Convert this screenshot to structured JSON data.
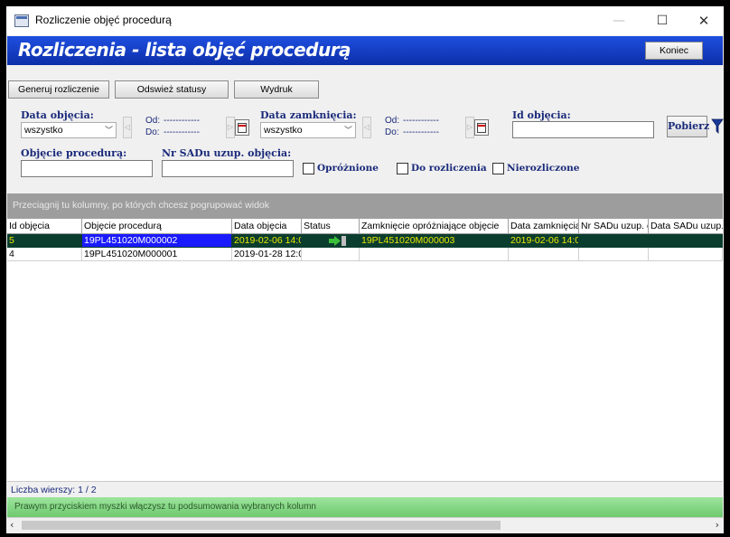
{
  "window": {
    "title": "Rozliczenie objęć procedurą",
    "min": "—",
    "max": "☐",
    "close": "✕"
  },
  "header": {
    "title": "Rozliczenia - lista objęć procedurą",
    "close_button": "Koniec"
  },
  "toolbar": {
    "generate": "Generuj rozliczenie",
    "refresh": "Odswież statusy",
    "print": "Wydruk"
  },
  "filters": {
    "open_date_label": "Data objęcia:",
    "open_date_value": "wszystko",
    "open_from_label": "Od:",
    "open_from_value": "------------",
    "open_to_label": "Do:",
    "open_to_value": "------------",
    "close_date_label": "Data zamknięcia:",
    "close_date_value": "wszystko",
    "close_from_label": "Od:",
    "close_from_value": "------------",
    "close_to_label": "Do:",
    "close_to_value": "------------",
    "id_label": "Id objęcia:",
    "id_value": "",
    "fetch_button": "Pobierz",
    "procedure_label": "Objęcie procedurą:",
    "procedure_value": "",
    "sadu_label": "Nr SADu uzup. objęcia:",
    "sadu_value": "",
    "emptied_label": "Opróżnione",
    "to_settle_label": "Do rozliczenia",
    "unsettled_label": "Nierozliczone"
  },
  "group_bar": "Przeciągnij tu kolumny, po których chcesz pogrupować widok",
  "table": {
    "columns": [
      "Id objęcia",
      "Objęcie procedurą",
      "Data objęcia",
      "Status",
      "Zamknięcie opróżniające objęcie",
      "Data zamknięcia",
      "Nr SADu uzup. ob",
      "Data SADu uzup."
    ],
    "rows": [
      [
        "5",
        "19PL451020M000002",
        "2019-02-06 14:0",
        "",
        "19PL451020M000003",
        "2019-02-06 14:0",
        "",
        ""
      ],
      [
        "4",
        "19PL451020M000001",
        "2019-01-28 12:0",
        "",
        "",
        "",
        "",
        ""
      ]
    ]
  },
  "row_count": "Liczba wierszy: 1 / 2",
  "summary_bar": "Prawym przyciskiem myszki włączysz tu podsumowania wybranych kolumn",
  "colors": {
    "banner": "#1e4fe0",
    "selected_row": "#0b3d2e",
    "selected_text": "#e8e800",
    "summary_bar": "#7fd67f"
  }
}
